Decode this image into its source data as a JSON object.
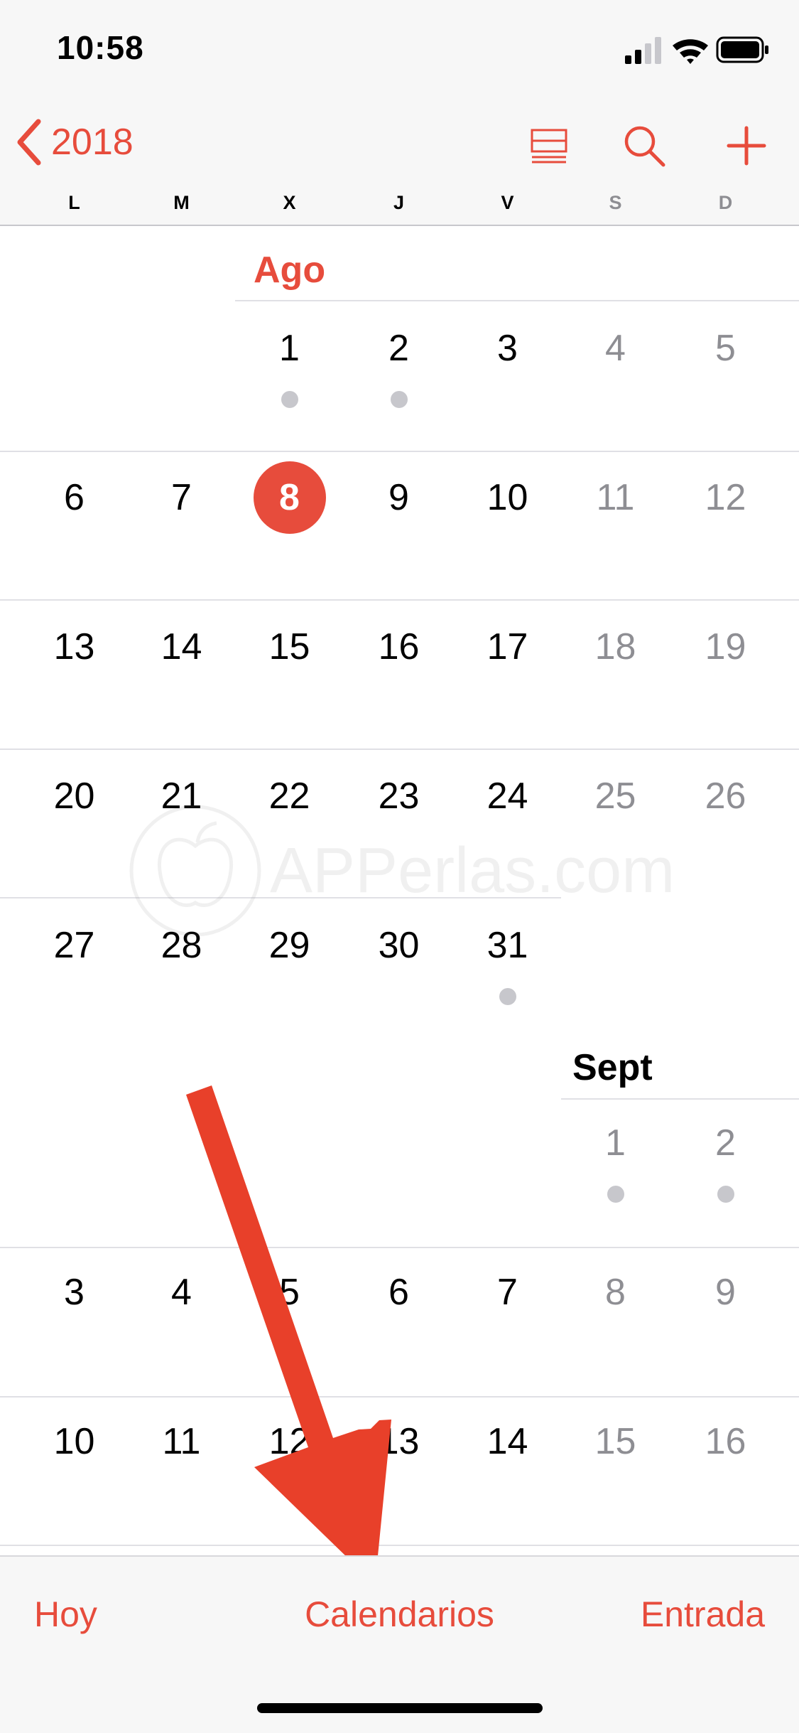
{
  "status_bar": {
    "time": "10:58"
  },
  "nav": {
    "back_label": "2018"
  },
  "weekdays": [
    "L",
    "M",
    "X",
    "J",
    "V",
    "S",
    "D"
  ],
  "months": [
    {
      "name": "Ago",
      "color": "#e74c3c"
    },
    {
      "name": "Sept",
      "color": "#000000"
    }
  ],
  "weeks": [
    {
      "days": [
        "",
        "",
        "1",
        "2",
        "3",
        "4",
        "5"
      ],
      "dots": [
        false,
        false,
        true,
        true,
        false,
        false,
        false
      ]
    },
    {
      "days": [
        "6",
        "7",
        "8",
        "9",
        "10",
        "11",
        "12"
      ],
      "today_index": 2
    },
    {
      "days": [
        "13",
        "14",
        "15",
        "16",
        "17",
        "18",
        "19"
      ]
    },
    {
      "days": [
        "20",
        "21",
        "22",
        "23",
        "24",
        "25",
        "26"
      ]
    },
    {
      "days": [
        "27",
        "28",
        "29",
        "30",
        "31",
        "",
        ""
      ],
      "dots": [
        false,
        false,
        false,
        false,
        true,
        false,
        false
      ]
    },
    {
      "days": [
        "",
        "",
        "",
        "",
        "",
        "1",
        "2"
      ],
      "dots": [
        false,
        false,
        false,
        false,
        false,
        true,
        true
      ]
    },
    {
      "days": [
        "3",
        "4",
        "5",
        "6",
        "7",
        "8",
        "9"
      ]
    },
    {
      "days": [
        "10",
        "11",
        "12",
        "13",
        "14",
        "15",
        "16"
      ]
    }
  ],
  "watermark": {
    "text": "APPerlas.com"
  },
  "tabbar": {
    "today": "Hoy",
    "calendars": "Calendarios",
    "inbox": "Entrada"
  },
  "colors": {
    "accent": "#e74c3c",
    "weekend": "#8e8e93",
    "dot": "#c7c7cc",
    "arrow": "#e8402a"
  }
}
